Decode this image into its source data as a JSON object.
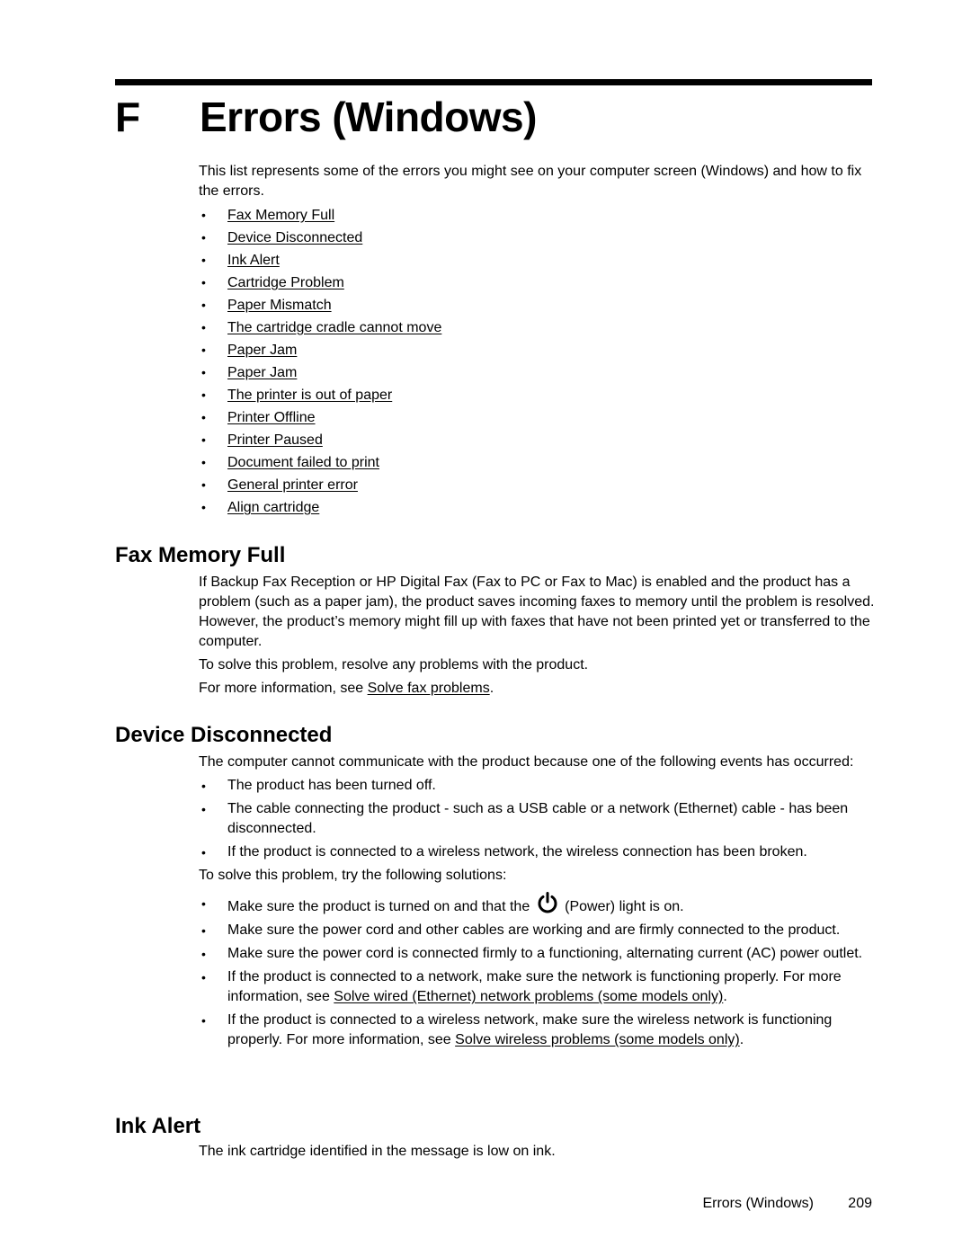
{
  "chapter": {
    "letter": "F",
    "title": "Errors (Windows)",
    "intro": "This list represents some of the errors you might see on your computer screen (Windows) and how to fix the errors.",
    "toc": [
      "Fax Memory Full",
      "Device Disconnected",
      "Ink Alert",
      "Cartridge Problem",
      "Paper Mismatch",
      "The cartridge cradle cannot move",
      "Paper Jam",
      "Paper Jam",
      "The printer is out of paper",
      "Printer Offline",
      "Printer Paused",
      "Document failed to print",
      "General printer error",
      "Align cartridge"
    ]
  },
  "fax_memory_full": {
    "heading": "Fax Memory Full",
    "para1": "If Backup Fax Reception or HP Digital Fax (Fax to PC or Fax to Mac) is enabled and the product has a problem (such as a paper jam), the product saves incoming faxes to memory until the problem is resolved. However, the product’s memory might fill up with faxes that have not been printed yet or transferred to the computer.",
    "para2": "To solve this problem, resolve any problems with the product.",
    "para3_prefix": "For more information, see ",
    "para3_link": "Solve fax problems",
    "para3_suffix": "."
  },
  "device_disconnected": {
    "heading": "Device Disconnected",
    "intro": "The computer cannot communicate with the product because one of the following events has occurred:",
    "events": [
      "The product has been turned off.",
      "The cable connecting the product - such as a USB cable or a network (Ethernet) cable - has been disconnected.",
      "If the product is connected to a wireless network, the wireless connection has been broken."
    ],
    "solutions_intro": "To solve this problem, try the following solutions:",
    "solution1_prefix": "Make sure the product is turned on and that the",
    "solution1_icon": "power-icon",
    "solution1_suffix": "(Power) light is on.",
    "solution2": "Make sure the power cord and other cables are working and are firmly connected to the product.",
    "solution3": "Make sure the power cord is connected firmly to a functioning, alternating current (AC) power outlet.",
    "solution4_prefix": "If the product is connected to a network, make sure the network is functioning properly. For more information, see ",
    "solution4_link": "Solve wired (Ethernet) network problems (some models only)",
    "solution4_suffix": ".",
    "solution5_prefix": "If the product is connected to a wireless network, make sure the wireless network is functioning properly. For more information, see ",
    "solution5_link": "Solve wireless problems (some models only)",
    "solution5_suffix": "."
  },
  "ink_alert": {
    "heading": "Ink Alert",
    "text": "The ink cartridge identified in the message is low on ink."
  },
  "footer": {
    "title": "Errors (Windows)",
    "page": "209"
  }
}
